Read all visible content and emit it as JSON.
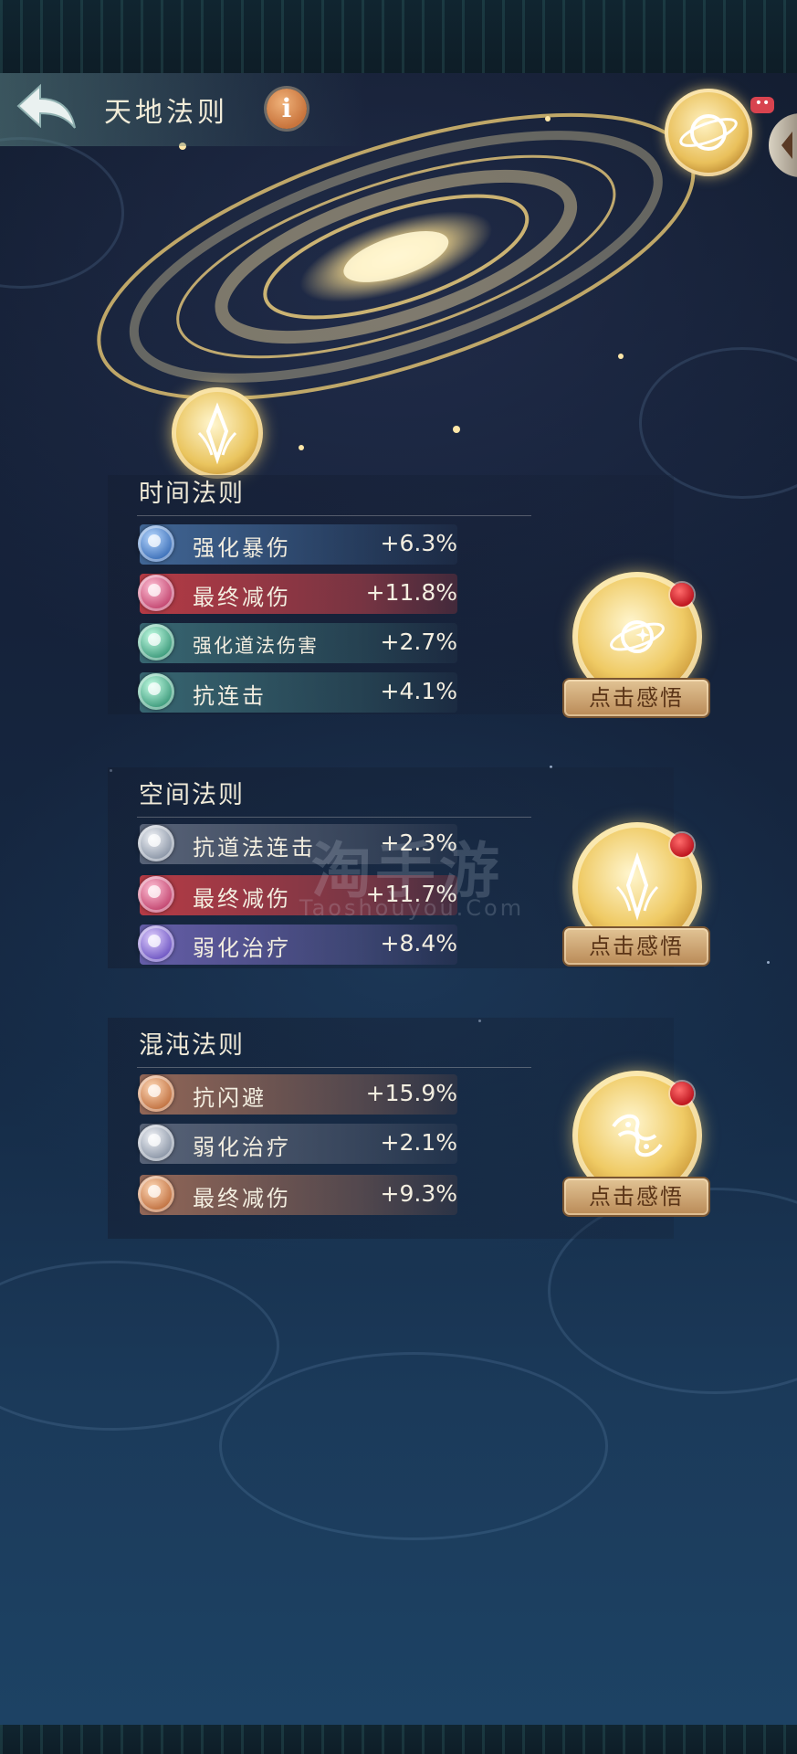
{
  "header": {
    "title": "天地法则",
    "info_icon_text": "i",
    "badge_text": "••"
  },
  "sections": [
    {
      "title": "时间法则",
      "button_label": "点击感悟",
      "emblem": "galaxy-emblem-icon",
      "stats": [
        {
          "name": "强化暴伤",
          "value": "+6.3%",
          "style": "blue"
        },
        {
          "name": "最终减伤",
          "value": "+11.8%",
          "style": "red"
        },
        {
          "name": "强化道法伤害",
          "value": "+2.7%",
          "style": "teal"
        },
        {
          "name": "抗连击",
          "value": "+4.1%",
          "style": "teal"
        }
      ]
    },
    {
      "title": "空间法则",
      "button_label": "点击感悟",
      "emblem": "crystal-emblem-icon",
      "stats": [
        {
          "name": "抗道法连击",
          "value": "+2.3%",
          "style": "grey"
        },
        {
          "name": "最终减伤",
          "value": "+11.7%",
          "style": "red"
        },
        {
          "name": "弱化治疗",
          "value": "+8.4%",
          "style": "violet"
        }
      ]
    },
    {
      "title": "混沌法则",
      "button_label": "点击感悟",
      "emblem": "yin-yang-emblem-icon",
      "stats": [
        {
          "name": "抗闪避",
          "value": "+15.9%",
          "style": "brown"
        },
        {
          "name": "弱化治疗",
          "value": "+2.1%",
          "style": "grey"
        },
        {
          "name": "最终减伤",
          "value": "+9.3%",
          "style": "brown"
        }
      ]
    }
  ],
  "watermark": {
    "main": "淘手游",
    "sub": "Taoshouyou.Com"
  },
  "colors": {
    "gold": "#efca64",
    "notification_red": "#c01822",
    "background": "#15223a"
  }
}
